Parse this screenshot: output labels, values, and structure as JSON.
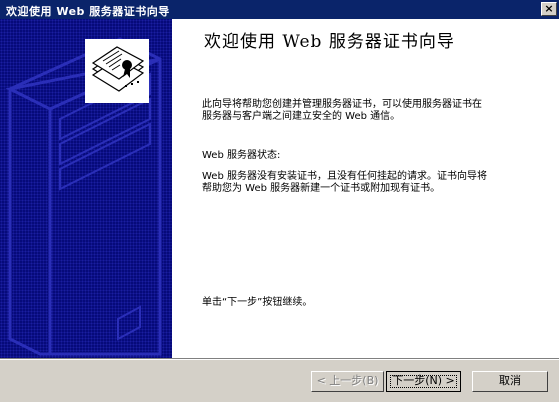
{
  "window": {
    "title": "欢迎使用 Web 服务器证书向导",
    "close_label": "×"
  },
  "main": {
    "heading": "欢迎使用 Web 服务器证书向导",
    "intro": "此向导将帮助您创建并管理服务器证书，可以使用服务器证书在服务器与客户端之间建立安全的 Web 通信。",
    "status_label": "Web 服务器状态:",
    "status_text": "Web 服务器没有安装证书，且没有任何挂起的请求。证书向导将帮助您为 Web 服务器新建一个证书或附加现有证书。",
    "continue_hint": "单击“下一步”按钮继续。"
  },
  "buttons": {
    "back_label": "< 上一步(B)",
    "next_label": "下一步(N) >",
    "cancel_label": "取消"
  },
  "icons": {
    "wizard_icon": "certificate-documents-icon",
    "side_art": "server-tower-graphic"
  },
  "colors": {
    "titlebar": "#0a246a",
    "side_panel": "#060a7a",
    "dialog_face": "#d4d0c8"
  }
}
